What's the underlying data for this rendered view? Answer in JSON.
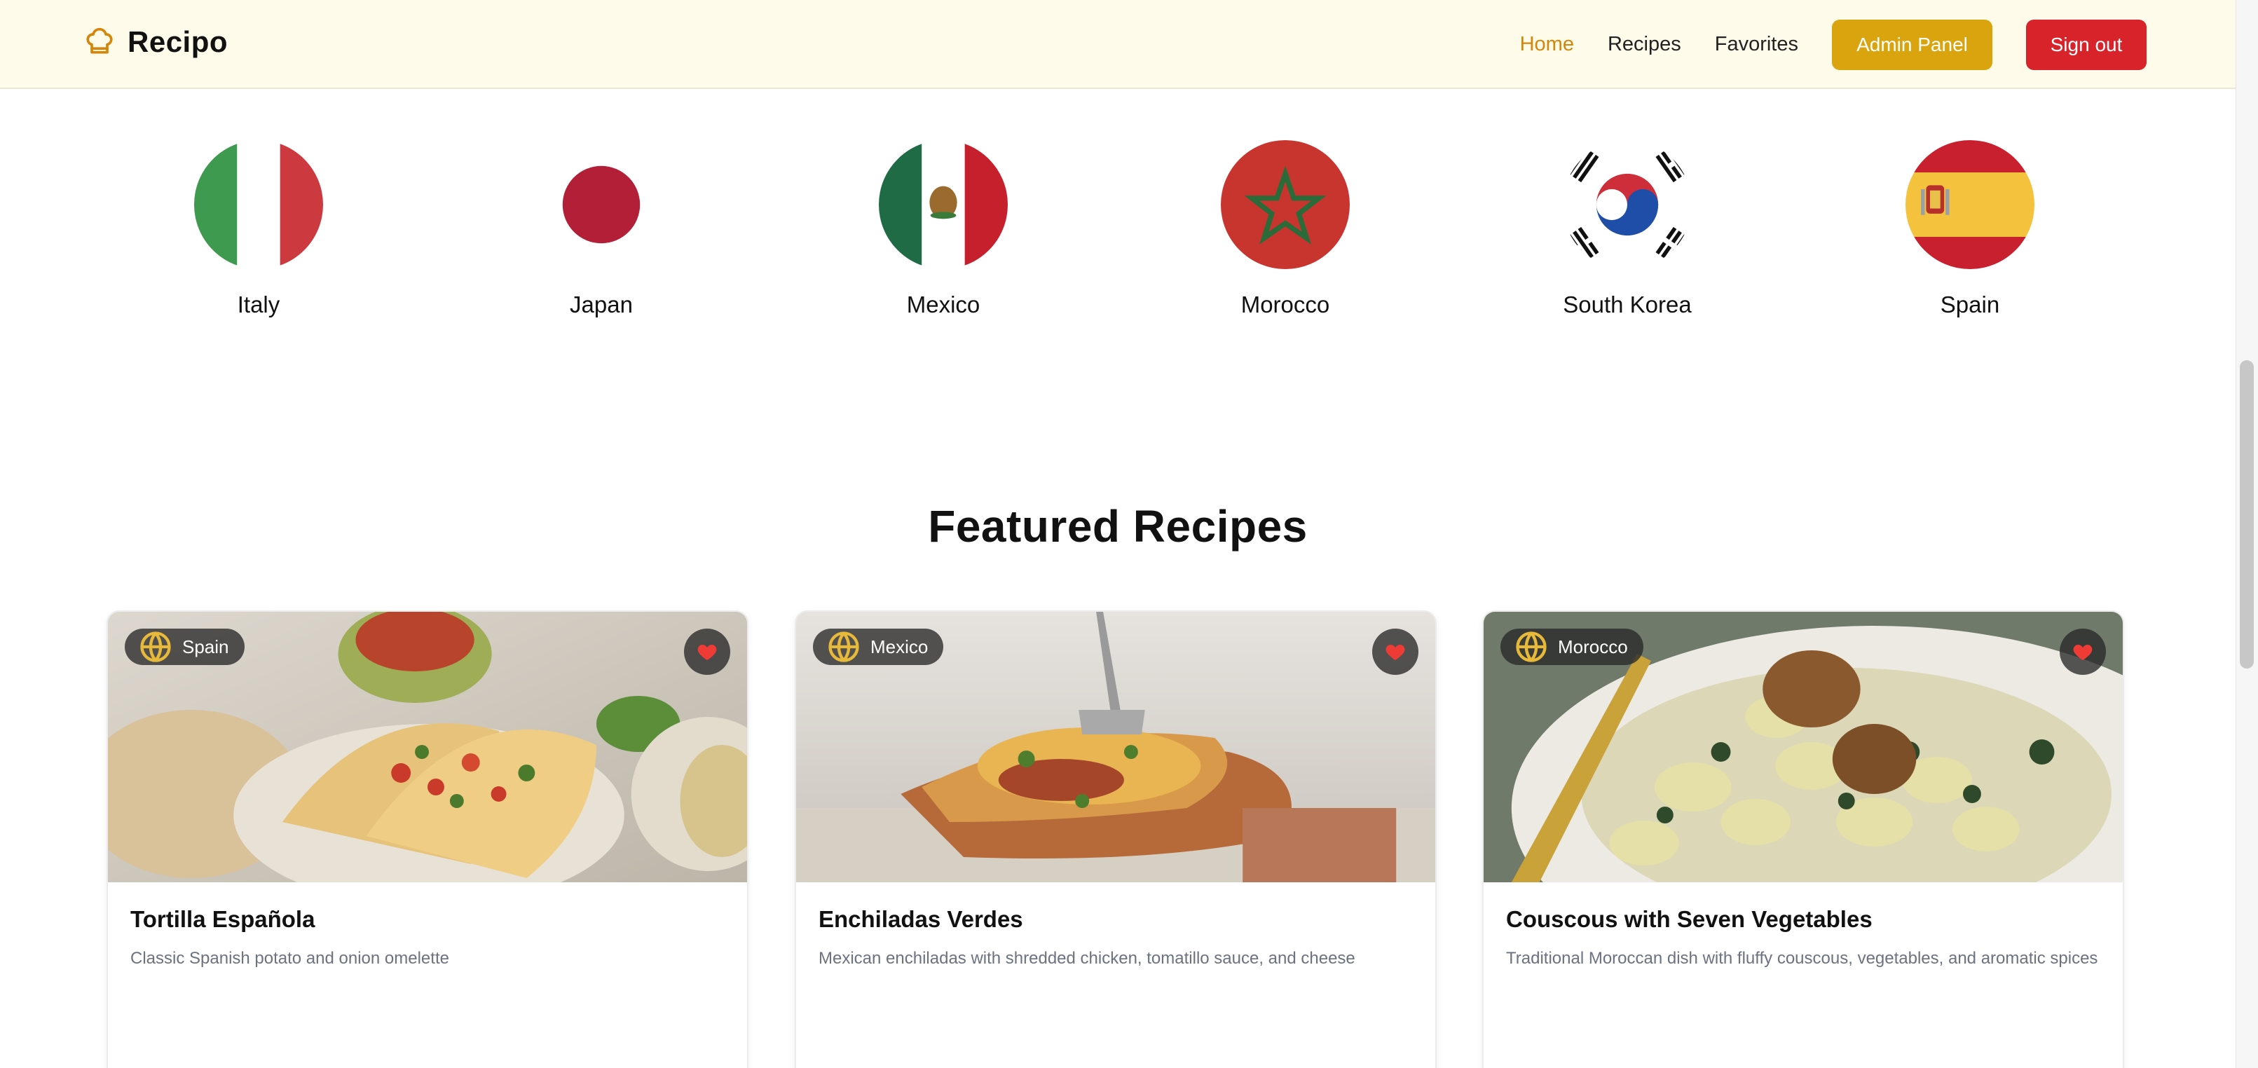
{
  "app": {
    "name": "Recipo",
    "logo_icon": "chef-hat-icon",
    "accent": "#d4860a",
    "brand_bg": "#fefbea"
  },
  "nav": {
    "links": [
      {
        "label": "Home",
        "active": true
      },
      {
        "label": "Recipes",
        "active": false
      },
      {
        "label": "Favorites",
        "active": false
      }
    ],
    "admin_label": "Admin Panel",
    "signout_label": "Sign out",
    "admin_color": "#d9a40d",
    "signout_color": "#d8232a"
  },
  "countries": [
    {
      "name": "Italy",
      "flag": "italy-flag"
    },
    {
      "name": "Japan",
      "flag": "japan-flag"
    },
    {
      "name": "Mexico",
      "flag": "mexico-flag"
    },
    {
      "name": "Morocco",
      "flag": "morocco-flag"
    },
    {
      "name": "South Korea",
      "flag": "south-korea-flag"
    },
    {
      "name": "Spain",
      "flag": "spain-flag"
    }
  ],
  "featured": {
    "title": "Featured Recipes",
    "recipes": [
      {
        "country": "Spain",
        "title": "Tortilla Española",
        "description": "Classic Spanish potato and onion omelette",
        "favorited": true
      },
      {
        "country": "Mexico",
        "title": "Enchiladas Verdes",
        "description": "Mexican enchiladas with shredded chicken, tomatillo sauce, and cheese",
        "favorited": true
      },
      {
        "country": "Morocco",
        "title": "Couscous with Seven Vegetables",
        "description": "Traditional Moroccan dish with fluffy couscous, vegetables, and aromatic spices",
        "favorited": true
      }
    ]
  }
}
